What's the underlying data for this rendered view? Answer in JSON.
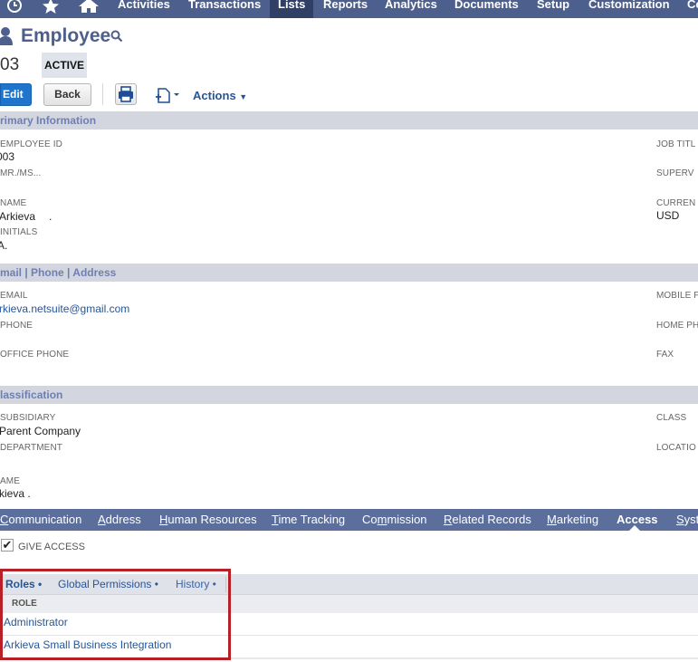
{
  "nav": {
    "items": [
      "Activities",
      "Transactions",
      "Lists",
      "Reports",
      "Analytics",
      "Documents",
      "Setup",
      "Customization",
      "Co"
    ],
    "active": "Lists"
  },
  "header": {
    "title": "Employee",
    "record_id": "03",
    "status": "ACTIVE"
  },
  "toolbar": {
    "edit_label": "Edit",
    "back_label": "Back",
    "actions_label": "Actions"
  },
  "primary_info": {
    "section_title": "rimary Information",
    "employee_id_label": "EMPLOYEE ID",
    "employee_id_value": "003",
    "mrms_label": "MR./MS...",
    "name_label": "NAME",
    "name_value": "Arkieva",
    "name_suffix": ".",
    "initials_label": "INITIALS",
    "initials_value": "A.",
    "job_title_label": "JOB TITL",
    "supervisor_label": "SUPERV",
    "currency_label": "CURREN",
    "currency_value": "USD"
  },
  "contact": {
    "section_title": "mail | Phone | Address",
    "email_label": "EMAIL",
    "email_value": "rkieva.netsuite@gmail.com",
    "phone_label": "PHONE",
    "office_phone_label": "OFFICE PHONE",
    "mobile_label": "MOBILE P",
    "home_phone_label": "HOME PH",
    "fax_label": "FAX"
  },
  "classification": {
    "section_title": "lassification",
    "subsidiary_label": "SUBSIDIARY",
    "subsidiary_value": "Parent Company",
    "department_label": "DEPARTMENT",
    "class_label": "CLASS",
    "location_label": "LOCATIO",
    "name_label": "AME",
    "name_value": "kieva ."
  },
  "subtabs": {
    "items": [
      {
        "first": "C",
        "rest": "ommunication"
      },
      {
        "first": "A",
        "rest": "ddress"
      },
      {
        "first": "H",
        "rest": "uman Resources"
      },
      {
        "first": "T",
        "rest": "ime Tracking"
      },
      {
        "pre": "Co",
        "first": "m",
        "rest": "mission"
      },
      {
        "first": "R",
        "rest": "elated Records"
      },
      {
        "first": "M",
        "rest": "arketing"
      },
      {
        "label": "Access"
      },
      {
        "first": "S",
        "rest": "yst"
      }
    ]
  },
  "access": {
    "give_access_label": "GIVE ACCESS",
    "give_access_checked": true,
    "tabs": [
      "Roles",
      "Global Permissions",
      "History"
    ],
    "active_tab": "Roles",
    "role_header": "ROLE",
    "roles": [
      "Administrator",
      "Arkieva Small Business Integration"
    ]
  }
}
